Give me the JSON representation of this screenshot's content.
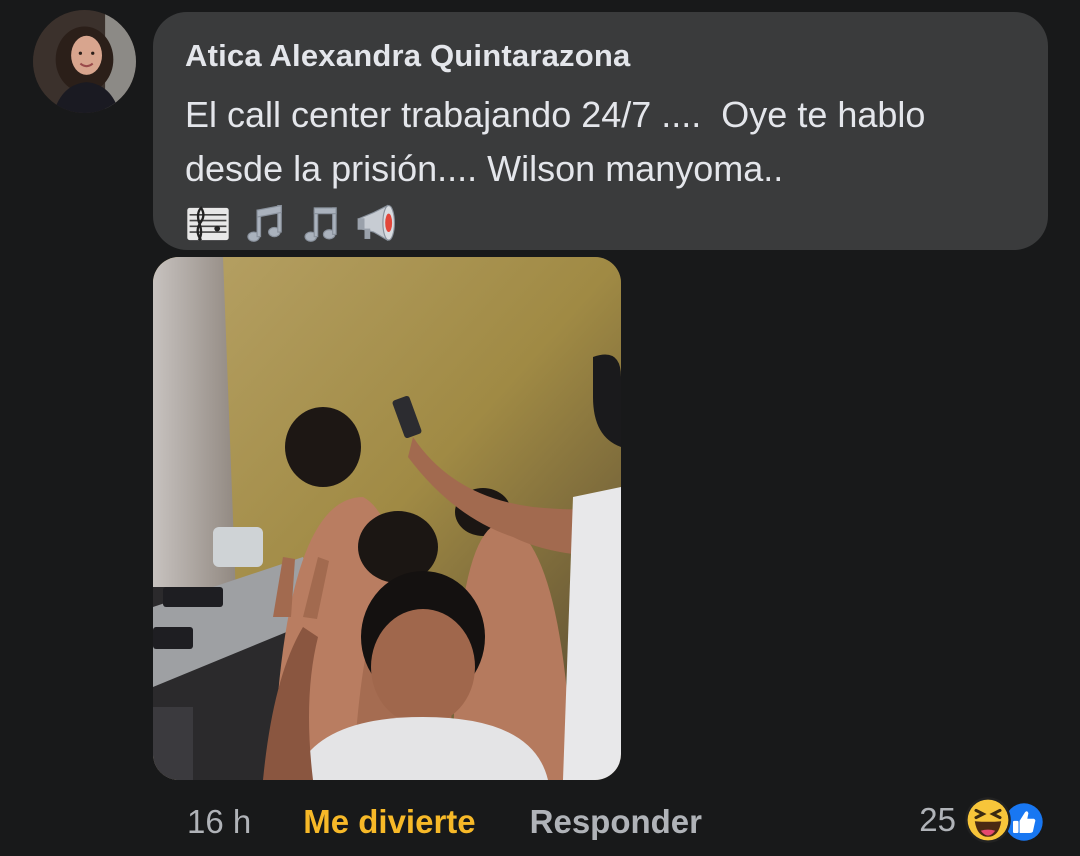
{
  "comment": {
    "author": "Atica Alexandra Quintarazona",
    "text": "El call center trabajando 24/7 ....  Oye te hablo desde la prisión.... Wilson manyoma..",
    "emojis": [
      "musical-score-icon",
      "musical-notes-icon",
      "musical-note-icon",
      "loudspeaker-icon"
    ]
  },
  "actions": {
    "time": "16 h",
    "react_label": "Me divierte",
    "react_color": "#f7b928",
    "reply_label": "Responder"
  },
  "reactions": {
    "count": "25",
    "icons": [
      "haha-reaction-icon",
      "like-reaction-icon"
    ]
  },
  "colors": {
    "background": "#18191a",
    "bubble": "#3a3b3c",
    "text": "#e4e6eb",
    "secondary_text": "#b0b3b8",
    "like_blue": "#1877f2"
  }
}
